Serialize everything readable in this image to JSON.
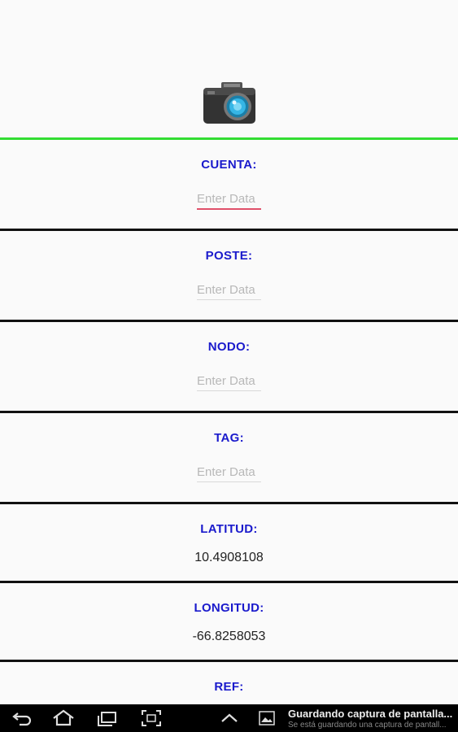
{
  "app": {
    "camera_icon": "camera-icon",
    "accent_color": "#33dd33"
  },
  "form": {
    "cuenta": {
      "label": "CUENTA:",
      "placeholder": "Enter Data",
      "value": ""
    },
    "poste": {
      "label": "POSTE:",
      "placeholder": "Enter Data",
      "value": ""
    },
    "nodo": {
      "label": "NODO:",
      "placeholder": "Enter Data",
      "value": ""
    },
    "tag": {
      "label": "TAG:",
      "placeholder": "Enter Data",
      "value": ""
    },
    "latitud": {
      "label": "LATITUD:",
      "value": "10.4908108"
    },
    "longitud": {
      "label": "LONGITUD:",
      "value": "-66.8258053"
    },
    "ref": {
      "label": "REF:"
    }
  },
  "navbar": {
    "back_icon": "back-icon",
    "home_icon": "home-icon",
    "recent_apps_icon": "recent-apps-icon",
    "screenshot_icon": "screenshot-icon",
    "up_icon": "chevron-up-icon",
    "notification": {
      "icon": "image-icon",
      "title": "Guardando captura de pantalla...",
      "subtitle": "Se está guardando una captura de pantall..."
    }
  }
}
